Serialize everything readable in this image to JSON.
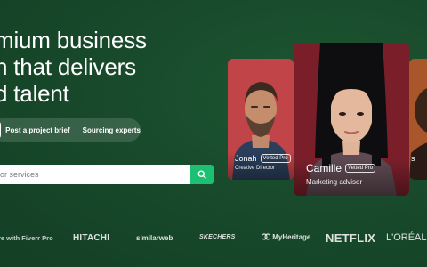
{
  "hero": {
    "headline_lines": [
      "mium business",
      "n that delivers",
      "d talent"
    ]
  },
  "tabs": {
    "active_label": "",
    "items": [
      "Post a project brief",
      "Sourcing experts"
    ]
  },
  "search": {
    "placeholder": "or services",
    "button_icon": "search-icon"
  },
  "cards": [
    {
      "name": "Jonah",
      "badge": "Vetted Pro",
      "role": "Creative Director",
      "color": "#c14448"
    },
    {
      "name": "Camille",
      "badge": "Vetted Pro",
      "role": "Marketing advisor",
      "color": "#7a1f2a"
    },
    {
      "name": "s",
      "role": "",
      "color": "#a8562a"
    }
  ],
  "trusted": {
    "label": "re with Fiverr Pro",
    "logos": [
      "HITACHI",
      "similarweb",
      "SKECHERS",
      "MyHeritage",
      "NETFLIX",
      "L'ORÉAL"
    ]
  },
  "colors": {
    "background": "#1a4a2c",
    "accent": "#1dbf73"
  }
}
